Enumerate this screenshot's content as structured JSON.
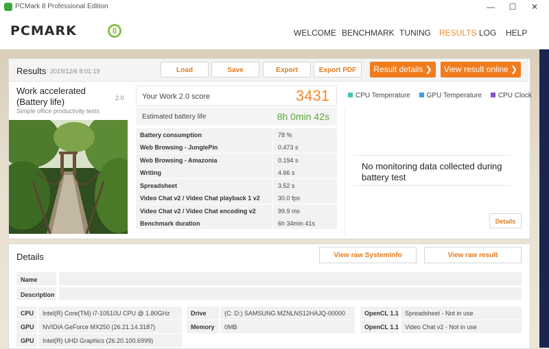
{
  "window": {
    "title": "PCMark 8 Professional Edition",
    "minimize": "—",
    "maximize": "☐",
    "close": "✕"
  },
  "header": {
    "logo": "PCMARK",
    "logo_num": "8",
    "nav": [
      "WELCOME",
      "BENCHMARK",
      "TUNING",
      "RESULTS",
      "LOG",
      "HELP"
    ],
    "active_nav": "RESULTS"
  },
  "results": {
    "title": "Results",
    "date": "2019/12/6 8:01:19",
    "buttons": {
      "load": "Load",
      "save": "Save",
      "export": "Export",
      "export_pdf": "Export PDF"
    },
    "result_details": "Result details ❯",
    "view_online": "View result online ❯"
  },
  "test": {
    "name": "Work accelerated (Battery life)",
    "version": "2.0",
    "subtitle": "Simple office productivity tests"
  },
  "score": {
    "label": "Your Work 2.0 score",
    "value": "3431",
    "battery_label": "Estimated battery life",
    "battery_value": "8h 0min 42s"
  },
  "metrics": [
    {
      "label": "Battery consumption",
      "value": "78 %"
    },
    {
      "label": "Web Browsing - JunglePin",
      "value": "0.473 s"
    },
    {
      "label": "Web Browsing - Amazonia",
      "value": "0.194 s"
    },
    {
      "label": "Writing",
      "value": "4.66 s"
    },
    {
      "label": "Spreadsheet",
      "value": "3.52 s"
    },
    {
      "label": "Video Chat v2 / Video Chat playback 1 v2",
      "value": "30.0 fps"
    },
    {
      "label": "Video Chat v2 / Video Chat encoding v2",
      "value": "99.9 ms"
    },
    {
      "label": "Benchmark duration",
      "value": "6h 34min 41s"
    }
  ],
  "monitoring": {
    "legend": [
      {
        "name": "CPU Temperature",
        "color": "#3cc8b4"
      },
      {
        "name": "GPU Temperature",
        "color": "#3aa0e0"
      },
      {
        "name": "CPU Clock",
        "color": "#8a4ec8"
      }
    ],
    "message": "No monitoring data collected during battery test",
    "details_button": "Details"
  },
  "details": {
    "title": "Details",
    "view_systeminfo": "View raw SystemInfo",
    "view_result": "View raw result",
    "name_label": "Name",
    "description_label": "Description",
    "cpu_label": "CPU",
    "cpu": "Intel(R) Core(TM) i7-10510U CPU @ 1.80GHz",
    "gpu_label": "GPU",
    "gpu1": "NVIDIA GeForce MX250 (26.21.14.3187)",
    "gpu2": "Intel(R) UHD Graphics (26.20.100.6999)",
    "drive_label": "Drive",
    "drive": "(C: D:) SAMSUNG MZNLNS12HAJQ-00000",
    "memory_label": "Memory",
    "memory": "0MB",
    "opencl_label": "OpenCL 1.1",
    "opencl1": "Spreadsheet - Not in use",
    "opencl2": "Video Chat v2 - Not in use"
  }
}
